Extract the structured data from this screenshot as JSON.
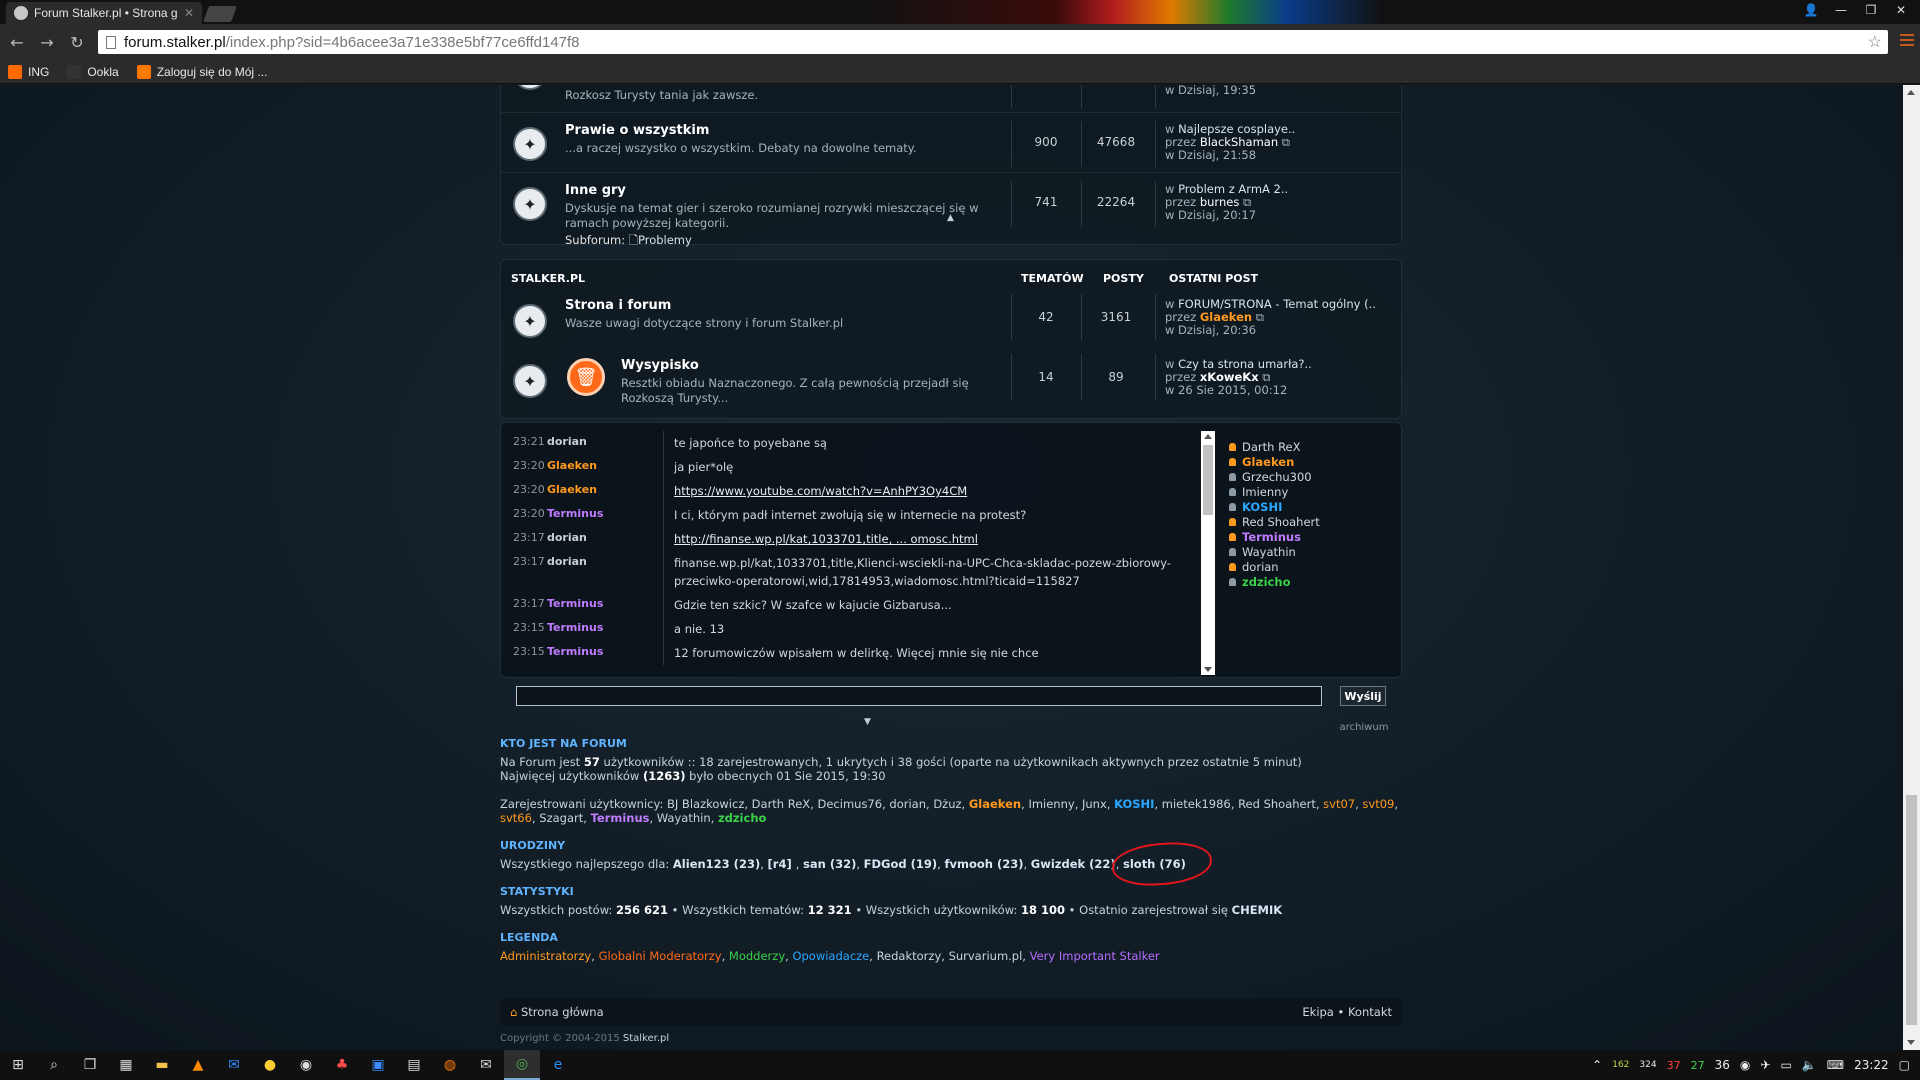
{
  "browser": {
    "tab_title": "Forum Stalker.pl • Strona g",
    "url_host": "forum.stalker.pl",
    "url_path": "/index.php?sid=4b6acee3a71e338e5bf77ce6ffd147f8",
    "bookmarks": [
      {
        "label": "ING",
        "color": "#ff6a00"
      },
      {
        "label": "Ookla",
        "color": "#333333"
      },
      {
        "label": "Zaloguj się do Mój ...",
        "color": "#ff7a00"
      }
    ]
  },
  "forums_top": [
    {
      "name": "",
      "desc": "Rozkosz Turysty tania jak zawsze.",
      "topics": "",
      "posts": "",
      "last_title": "",
      "last_by": "",
      "last_when": "w Dzisiaj, 19:35"
    },
    {
      "name": "Prawie o wszystkim",
      "desc": "...a raczej wszystko o wszystkim. Debaty na dowolne tematy.",
      "topics": "900",
      "posts": "47668",
      "last_title": "Najlepsze cosplaye..",
      "last_by": "BlackShaman",
      "last_when": "w Dzisiaj, 21:58"
    },
    {
      "name": "Inne gry",
      "desc": "Dyskusje na temat gier i szeroko rozumianej rozrywki mieszczącej się w ramach powyższej kategorii.",
      "topics": "741",
      "posts": "22264",
      "last_title": "Problem z ArmA 2..",
      "last_by": "burnes",
      "last_when": "w Dzisiaj, 20:17",
      "subforum_label": "Subforum:",
      "subforum": "Problemy"
    }
  ],
  "category": {
    "title": "STALKER.PL",
    "col_topics": "TEMATÓW",
    "col_posts": "POSTY",
    "col_last": "OSTATNI POST",
    "forums": [
      {
        "name": "Strona i forum",
        "desc": "Wasze uwagi dotyczące strony i forum Stalker.pl",
        "topics": "42",
        "posts": "3161",
        "last_title": "FORUM/STRONA - Temat ogólny (..",
        "last_by": "Glaeken",
        "last_when": "w Dzisiaj, 20:36"
      },
      {
        "name": "Wysypisko",
        "desc": "Resztki obiadu Naznaczonego. Z całą pewnością przejadł się Rozkoszą Turysty...",
        "topics": "14",
        "posts": "89",
        "last_title": "Czy ta strona umarła?..",
        "last_by": "xKoweKx",
        "last_when": "w 26 Sie 2015, 00:12"
      }
    ],
    "in_prefix": "w ",
    "by_prefix": "przez "
  },
  "shoutbox": {
    "messages": [
      {
        "time": "23:21",
        "user": "dorian",
        "cls": "dorian",
        "text": "te japońce to poyebane są",
        "link": false
      },
      {
        "time": "23:20",
        "user": "Glaeken",
        "cls": "glaeken",
        "text": "ja pier*olę",
        "link": false
      },
      {
        "time": "23:20",
        "user": "Glaeken",
        "cls": "glaeken",
        "text": "https://www.youtube.com/watch?v=AnhPY3Oy4CM",
        "link": true
      },
      {
        "time": "23:20",
        "user": "Terminus",
        "cls": "terminus",
        "text": "I ci, którym padł internet zwołują się w internecie na protest?",
        "link": false
      },
      {
        "time": "23:17",
        "user": "dorian",
        "cls": "dorian",
        "text": "http://finanse.wp.pl/kat,1033701,title, ... omosc.html",
        "link": true
      },
      {
        "time": "23:17",
        "user": "dorian",
        "cls": "dorian",
        "text": "finanse.wp.pl/kat,1033701,title,Klienci-wsciekli-na-UPC-Chca-skladac-pozew-zbiorowy-przeciwko-operatorowi,wid,17814953,wiadomosc.html?ticaid=115827",
        "link": false
      },
      {
        "time": "23:17",
        "user": "Terminus",
        "cls": "terminus",
        "text": "Gdzie ten szkic? W szafce w kajucie Gizbarusa...",
        "link": false
      },
      {
        "time": "23:15",
        "user": "Terminus",
        "cls": "terminus",
        "text": "a nie. 13",
        "link": false
      },
      {
        "time": "23:15",
        "user": "Terminus",
        "cls": "terminus",
        "text": "12 forumowiczów wpisałem w delirkę. Więcej mnie się nie chce",
        "link": false
      }
    ],
    "online": [
      {
        "name": "Darth ReX",
        "cls": "",
        "dot": "orange"
      },
      {
        "name": "Glaeken",
        "cls": "glaeken",
        "dot": "orange"
      },
      {
        "name": "Grzechu300",
        "cls": "",
        "dot": "gray"
      },
      {
        "name": "Imienny",
        "cls": "",
        "dot": "gray"
      },
      {
        "name": "KOSHI",
        "cls": "koshi",
        "dot": "gray"
      },
      {
        "name": "Red Shoahert",
        "cls": "",
        "dot": "orange"
      },
      {
        "name": "Terminus",
        "cls": "terminus",
        "dot": "orange"
      },
      {
        "name": "Wayathin",
        "cls": "",
        "dot": "gray"
      },
      {
        "name": "dorian",
        "cls": "",
        "dot": "orange"
      },
      {
        "name": "zdzicho",
        "cls": "zdzicho",
        "dot": "gray"
      }
    ],
    "send_label": "Wyślij",
    "archive_label": "archiwum"
  },
  "who": {
    "heading": "KTO JEST NA FORUM",
    "line1_pre": "Na Forum jest ",
    "line1_count": "57",
    "line1_post": " użytkowników :: 18 zarejestrowanych, 1 ukrytych i 38 gości (oparte na użytkownikach aktywnych przez ostatnie 5 minut)",
    "line2_pre": "Najwięcej użytkowników ",
    "line2_count": "(1263)",
    "line2_post": " było obecnych 01 Sie 2015, 19:30",
    "reg_label": "Zarejestrowani użytkownicy: ",
    "users": [
      {
        "name": "BJ Blazkowicz",
        "cls": ""
      },
      {
        "name": "Darth ReX",
        "cls": ""
      },
      {
        "name": "Decimus76",
        "cls": ""
      },
      {
        "name": "dorian",
        "cls": ""
      },
      {
        "name": "Dżuz",
        "cls": ""
      },
      {
        "name": "Glaeken",
        "cls": "c-orange"
      },
      {
        "name": "Imienny",
        "cls": ""
      },
      {
        "name": "Junx",
        "cls": ""
      },
      {
        "name": "KOSHI",
        "cls": "c-blue"
      },
      {
        "name": "mietek1986",
        "cls": ""
      },
      {
        "name": "Red Shoahert",
        "cls": ""
      },
      {
        "name": "svt07",
        "cls": "c-mod"
      },
      {
        "name": "svt09",
        "cls": "c-mod"
      },
      {
        "name": "svt66",
        "cls": "c-mod"
      },
      {
        "name": "Szagart",
        "cls": ""
      },
      {
        "name": "Terminus",
        "cls": "c-purple"
      },
      {
        "name": "Wayathin",
        "cls": ""
      },
      {
        "name": "zdzicho",
        "cls": "c-green"
      }
    ]
  },
  "birthdays": {
    "heading": "URODZINY",
    "label": "Wszystkiego najlepszego dla: ",
    "people": [
      "Alien123 (23)",
      "[r4] ",
      "san (32)",
      "FDGod (19)",
      "fvmooh (23)",
      "Gwizdek (22)",
      "sloth (76)"
    ]
  },
  "stats": {
    "heading": "STATYSTYKI",
    "posts_label": "Wszystkich postów: ",
    "posts": "256 621",
    "topics_label": "Wszystkich tematów: ",
    "topics": "12 321",
    "users_label": "Wszystkich użytkowników: ",
    "users": "18 100",
    "newest_label": "Ostatnio zarejestrował się ",
    "newest": "CHEMIK"
  },
  "legend": {
    "heading": "LEGENDA",
    "items": [
      {
        "label": "Administratorzy",
        "cls": "lg-admin"
      },
      {
        "label": "Globalni Moderatorzy",
        "cls": "lg-gmod"
      },
      {
        "label": "Modderzy",
        "cls": "lg-modd"
      },
      {
        "label": "Opowiadacze",
        "cls": "lg-opow"
      },
      {
        "label": "Redaktorzy",
        "cls": "lg-red"
      },
      {
        "label": "Survarium.pl",
        "cls": "lg-surv"
      },
      {
        "label": "Very Important Stalker",
        "cls": "lg-vip"
      }
    ]
  },
  "footer": {
    "home": "Strona główna",
    "team": "Ekipa",
    "contact": "Kontakt",
    "copyright": "Copyright © 2004-2015 ",
    "site": "Stalker.pl"
  },
  "taskbar": {
    "clock": "23:22",
    "tray_nums": [
      "162",
      "324",
      "37",
      "27",
      "36"
    ]
  }
}
